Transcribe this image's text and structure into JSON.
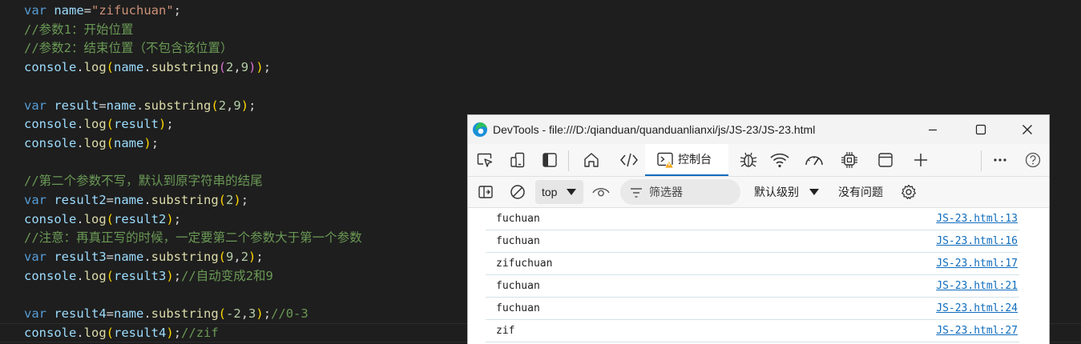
{
  "editor": {
    "lines": [
      [
        {
          "t": "var",
          "c": "kw"
        },
        {
          "t": " name",
          "c": "var"
        },
        {
          "t": "=",
          "c": "pun"
        },
        {
          "t": "\"zifuchuan\"",
          "c": "str"
        },
        {
          "t": ";",
          "c": "pun"
        }
      ],
      [
        {
          "t": "//参数1：开始位置",
          "c": "cmt"
        }
      ],
      [
        {
          "t": "//参数2：结束位置（不包含该位置）",
          "c": "cmt"
        }
      ],
      [
        {
          "t": "console",
          "c": "var"
        },
        {
          "t": ".",
          "c": "pun"
        },
        {
          "t": "log",
          "c": "fn"
        },
        {
          "t": "(",
          "c": "p1"
        },
        {
          "t": "name",
          "c": "var"
        },
        {
          "t": ".",
          "c": "pun"
        },
        {
          "t": "substring",
          "c": "fn"
        },
        {
          "t": "(",
          "c": "p2"
        },
        {
          "t": "2",
          "c": "num"
        },
        {
          "t": ",",
          "c": "pun"
        },
        {
          "t": "9",
          "c": "num"
        },
        {
          "t": ")",
          "c": "p2"
        },
        {
          "t": ")",
          "c": "p1"
        },
        {
          "t": ";",
          "c": "pun"
        }
      ],
      [],
      [
        {
          "t": "var",
          "c": "kw"
        },
        {
          "t": " result",
          "c": "var"
        },
        {
          "t": "=",
          "c": "pun"
        },
        {
          "t": "name",
          "c": "var"
        },
        {
          "t": ".",
          "c": "pun"
        },
        {
          "t": "substring",
          "c": "fn"
        },
        {
          "t": "(",
          "c": "p1"
        },
        {
          "t": "2",
          "c": "num"
        },
        {
          "t": ",",
          "c": "pun"
        },
        {
          "t": "9",
          "c": "num"
        },
        {
          "t": ")",
          "c": "p1"
        },
        {
          "t": ";",
          "c": "pun"
        }
      ],
      [
        {
          "t": "console",
          "c": "var"
        },
        {
          "t": ".",
          "c": "pun"
        },
        {
          "t": "log",
          "c": "fn"
        },
        {
          "t": "(",
          "c": "p1"
        },
        {
          "t": "result",
          "c": "var"
        },
        {
          "t": ")",
          "c": "p1"
        },
        {
          "t": ";",
          "c": "pun"
        }
      ],
      [
        {
          "t": "console",
          "c": "var"
        },
        {
          "t": ".",
          "c": "pun"
        },
        {
          "t": "log",
          "c": "fn"
        },
        {
          "t": "(",
          "c": "p1"
        },
        {
          "t": "name",
          "c": "var"
        },
        {
          "t": ")",
          "c": "p1"
        },
        {
          "t": ";",
          "c": "pun"
        }
      ],
      [],
      [
        {
          "t": "//第二个参数不写，默认到原字符串的结尾",
          "c": "cmt"
        }
      ],
      [
        {
          "t": "var",
          "c": "kw"
        },
        {
          "t": " result2",
          "c": "var"
        },
        {
          "t": "=",
          "c": "pun"
        },
        {
          "t": "name",
          "c": "var"
        },
        {
          "t": ".",
          "c": "pun"
        },
        {
          "t": "substring",
          "c": "fn"
        },
        {
          "t": "(",
          "c": "p1"
        },
        {
          "t": "2",
          "c": "num"
        },
        {
          "t": ")",
          "c": "p1"
        },
        {
          "t": ";",
          "c": "pun"
        }
      ],
      [
        {
          "t": "console",
          "c": "var"
        },
        {
          "t": ".",
          "c": "pun"
        },
        {
          "t": "log",
          "c": "fn"
        },
        {
          "t": "(",
          "c": "p1"
        },
        {
          "t": "result2",
          "c": "var"
        },
        {
          "t": ")",
          "c": "p1"
        },
        {
          "t": ";",
          "c": "pun"
        }
      ],
      [
        {
          "t": "//注意：再真正写的时候，一定要第二个参数大于第一个参数",
          "c": "cmt"
        }
      ],
      [
        {
          "t": "var",
          "c": "kw"
        },
        {
          "t": " result3",
          "c": "var"
        },
        {
          "t": "=",
          "c": "pun"
        },
        {
          "t": "name",
          "c": "var"
        },
        {
          "t": ".",
          "c": "pun"
        },
        {
          "t": "substring",
          "c": "fn"
        },
        {
          "t": "(",
          "c": "p1"
        },
        {
          "t": "9",
          "c": "num"
        },
        {
          "t": ",",
          "c": "pun"
        },
        {
          "t": "2",
          "c": "num"
        },
        {
          "t": ")",
          "c": "p1"
        },
        {
          "t": ";",
          "c": "pun"
        }
      ],
      [
        {
          "t": "console",
          "c": "var"
        },
        {
          "t": ".",
          "c": "pun"
        },
        {
          "t": "log",
          "c": "fn"
        },
        {
          "t": "(",
          "c": "p1"
        },
        {
          "t": "result3",
          "c": "var"
        },
        {
          "t": ")",
          "c": "p1"
        },
        {
          "t": ";",
          "c": "pun"
        },
        {
          "t": "//自动变成2和9",
          "c": "cmt"
        }
      ],
      [],
      [
        {
          "t": "var",
          "c": "kw"
        },
        {
          "t": " result4",
          "c": "var"
        },
        {
          "t": "=",
          "c": "pun"
        },
        {
          "t": "name",
          "c": "var"
        },
        {
          "t": ".",
          "c": "pun"
        },
        {
          "t": "substring",
          "c": "fn"
        },
        {
          "t": "(",
          "c": "p1"
        },
        {
          "t": "-2",
          "c": "num"
        },
        {
          "t": ",",
          "c": "pun"
        },
        {
          "t": "3",
          "c": "num"
        },
        {
          "t": ")",
          "c": "p1"
        },
        {
          "t": ";",
          "c": "pun"
        },
        {
          "t": "//0-3",
          "c": "cmt"
        }
      ],
      [
        {
          "t": "console",
          "c": "var"
        },
        {
          "t": ".",
          "c": "pun"
        },
        {
          "t": "log",
          "c": "fn"
        },
        {
          "t": "(",
          "c": "p1"
        },
        {
          "t": "result4",
          "c": "var"
        },
        {
          "t": ")",
          "c": "p1"
        },
        {
          "t": ";",
          "c": "pun"
        },
        {
          "t": "//zif",
          "c": "cmt"
        }
      ]
    ]
  },
  "devtools": {
    "title": "DevTools - file:///D:/qianduan/quanduanlianxi/js/JS-23/JS-23.html",
    "window_buttons": [
      "minimize-icon",
      "maximize-icon",
      "close-icon"
    ],
    "toolbar_icons": [
      "inspect-element-icon",
      "device-emulation-icon",
      "dock-side-icon",
      "welcome-home-icon",
      "elements-code-icon",
      "console-icon",
      "sources-bug-icon",
      "network-wifi-icon",
      "performance-gauge-icon",
      "memory-chip-icon",
      "application-window-icon",
      "add-tool-plus-icon",
      "more-ellipsis-icon",
      "help-question-icon"
    ],
    "console_tab_label": "控制台",
    "filterbar": {
      "context": "top",
      "filter_placeholder": "筛选器",
      "level": "默认级别",
      "issues": "没有问题"
    },
    "logs": [
      {
        "message": "fuchuan",
        "source": "JS-23.html:13"
      },
      {
        "message": "fuchuan",
        "source": "JS-23.html:16"
      },
      {
        "message": "zifuchuan",
        "source": "JS-23.html:17"
      },
      {
        "message": "fuchuan",
        "source": "JS-23.html:21"
      },
      {
        "message": "fuchuan",
        "source": "JS-23.html:24"
      },
      {
        "message": "zif",
        "source": "JS-23.html:27"
      }
    ],
    "colors": {
      "accent": "#0f6cbd",
      "warning": "#f7a81b"
    }
  }
}
